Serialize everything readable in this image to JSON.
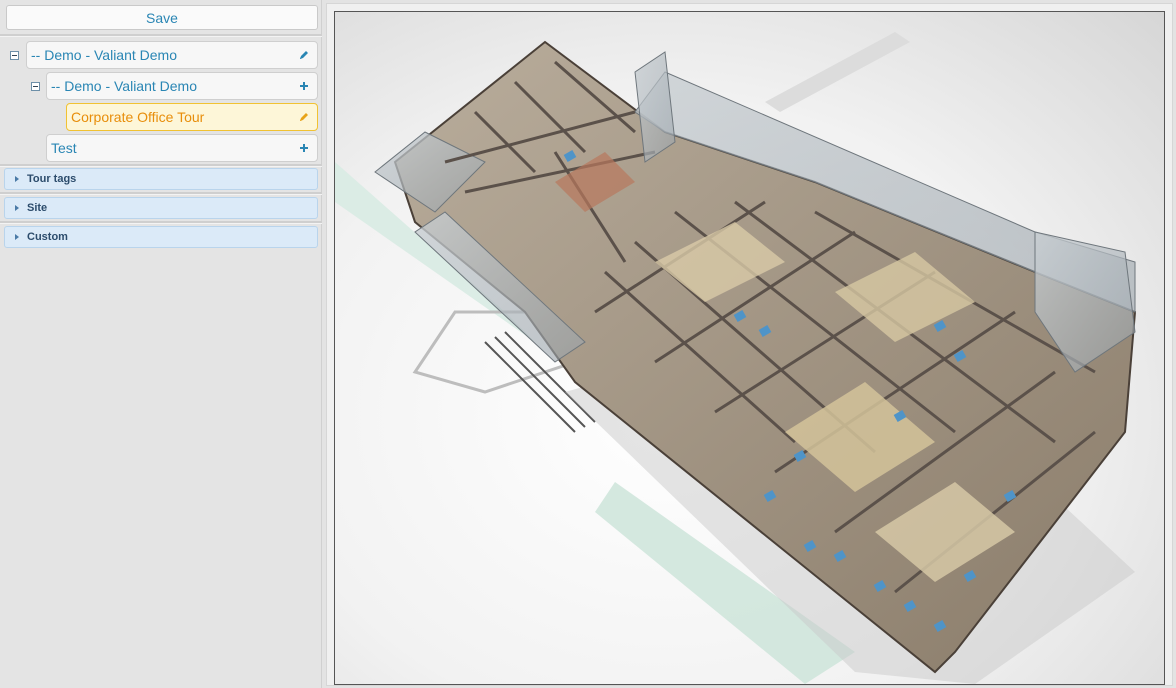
{
  "left_panel": {
    "save_label": "Save",
    "tree": [
      {
        "label": "-- Demo - Valiant Demo",
        "action": "edit"
      },
      {
        "label": "-- Demo - Valiant Demo",
        "action": "add"
      },
      {
        "label": "Corporate Office Tour",
        "action": "edit",
        "selected": true
      },
      {
        "label": "Test",
        "action": "add"
      }
    ],
    "sections": [
      {
        "label": "Tour tags"
      },
      {
        "label": "Site"
      },
      {
        "label": "Custom"
      }
    ]
  },
  "viewer": {
    "image": "3d-floor-plan-render",
    "colors": {
      "accent": "#2a86b4",
      "selected_border": "#f1c232",
      "selected_text": "#e88e0b",
      "section_bg": "#dbeaf8"
    }
  }
}
